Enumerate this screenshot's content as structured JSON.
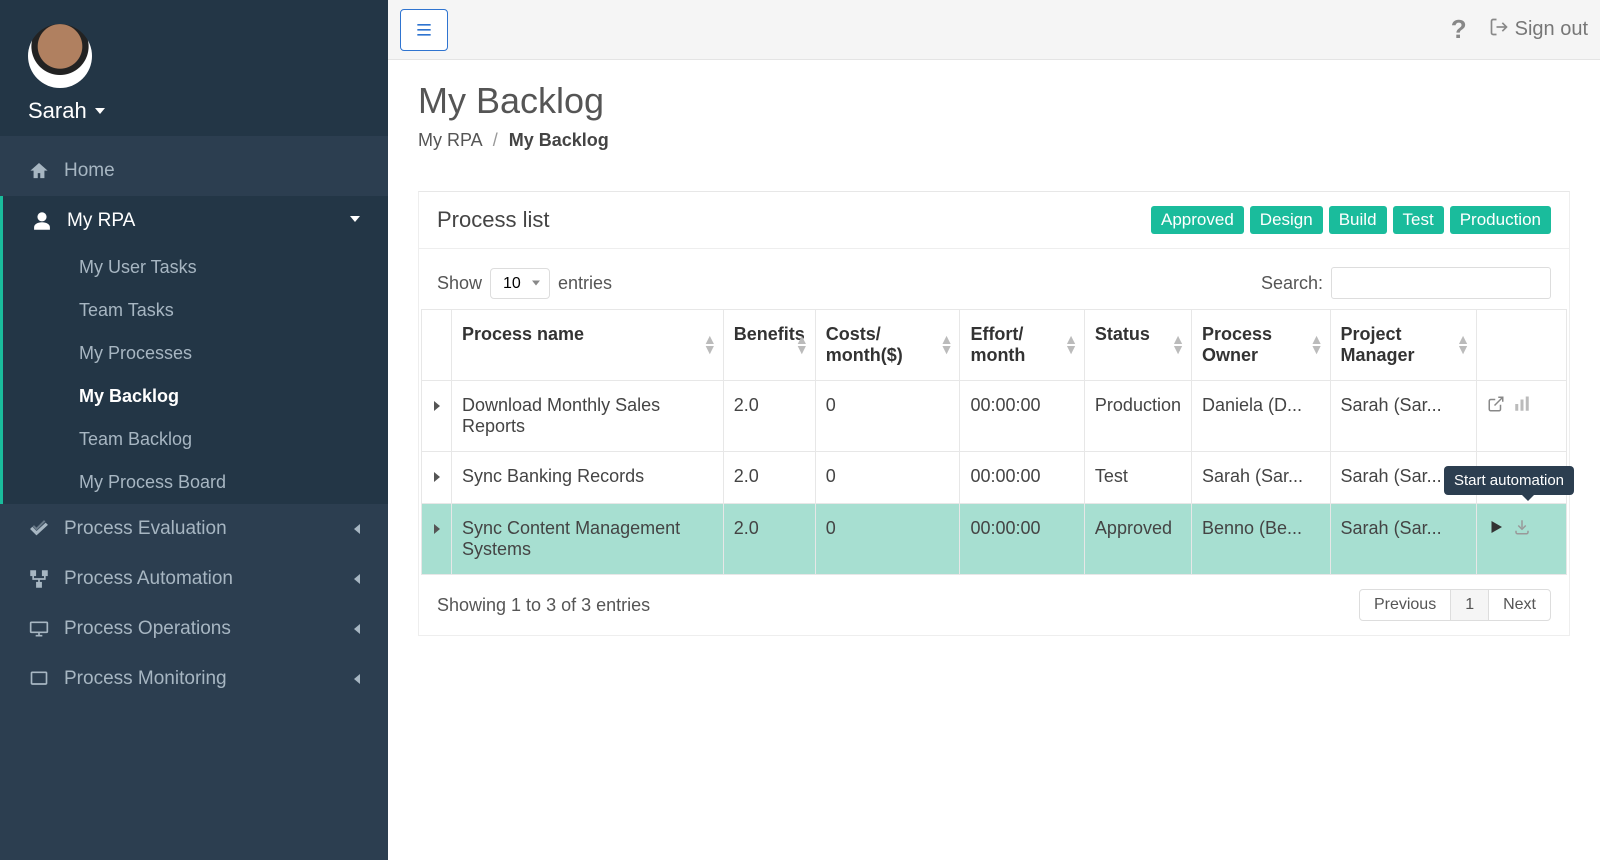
{
  "user": {
    "name": "Sarah"
  },
  "topbar": {
    "signout": "Sign out"
  },
  "sidebar": {
    "home": "Home",
    "nav": [
      {
        "label": "My RPA",
        "open": true,
        "icon": "user",
        "children": [
          {
            "label": "My User Tasks"
          },
          {
            "label": "Team Tasks"
          },
          {
            "label": "My Processes"
          },
          {
            "label": "My Backlog",
            "active": true
          },
          {
            "label": "Team Backlog"
          },
          {
            "label": "My Process Board"
          }
        ]
      },
      {
        "label": "Process Evaluation",
        "icon": "check"
      },
      {
        "label": "Process Automation",
        "icon": "flow"
      },
      {
        "label": "Process Operations",
        "icon": "screen"
      },
      {
        "label": "Process Monitoring",
        "icon": "monitor"
      }
    ]
  },
  "page": {
    "title": "My Backlog",
    "breadcrumb_root": "My RPA",
    "breadcrumb_current": "My Backlog"
  },
  "panel": {
    "title": "Process list",
    "badges": [
      "Approved",
      "Design",
      "Build",
      "Test",
      "Production"
    ]
  },
  "table": {
    "show_label": "Show",
    "entries_label": "entries",
    "length_value": "10",
    "search_label": "Search:",
    "search_value": "",
    "columns": [
      "Process name",
      "Benefits",
      "Costs/ month($)",
      "Effort/ month",
      "Status",
      "Process Owner",
      "Project Manager"
    ],
    "rows": [
      {
        "name": "Download Monthly Sales Reports",
        "benefits": "2.0",
        "costs": "0",
        "effort": "00:00:00",
        "status": "Production",
        "owner": "Daniela (D...",
        "manager": "Sarah (Sar...",
        "highlight": false,
        "action_mode": "open"
      },
      {
        "name": "Sync Banking Records",
        "benefits": "2.0",
        "costs": "0",
        "effort": "00:00:00",
        "status": "Test",
        "owner": "Sarah (Sar...",
        "manager": "Sarah (Sar...",
        "highlight": false,
        "action_mode": "open"
      },
      {
        "name": "Sync Content Management Systems",
        "benefits": "2.0",
        "costs": "0",
        "effort": "00:00:00",
        "status": "Approved",
        "owner": "Benno (Be...",
        "manager": "Sarah (Sar...",
        "highlight": true,
        "action_mode": "start",
        "tooltip": "Start automation"
      }
    ],
    "info": "Showing 1 to 3 of 3 entries",
    "pager": {
      "prev": "Previous",
      "page": "1",
      "next": "Next"
    }
  }
}
